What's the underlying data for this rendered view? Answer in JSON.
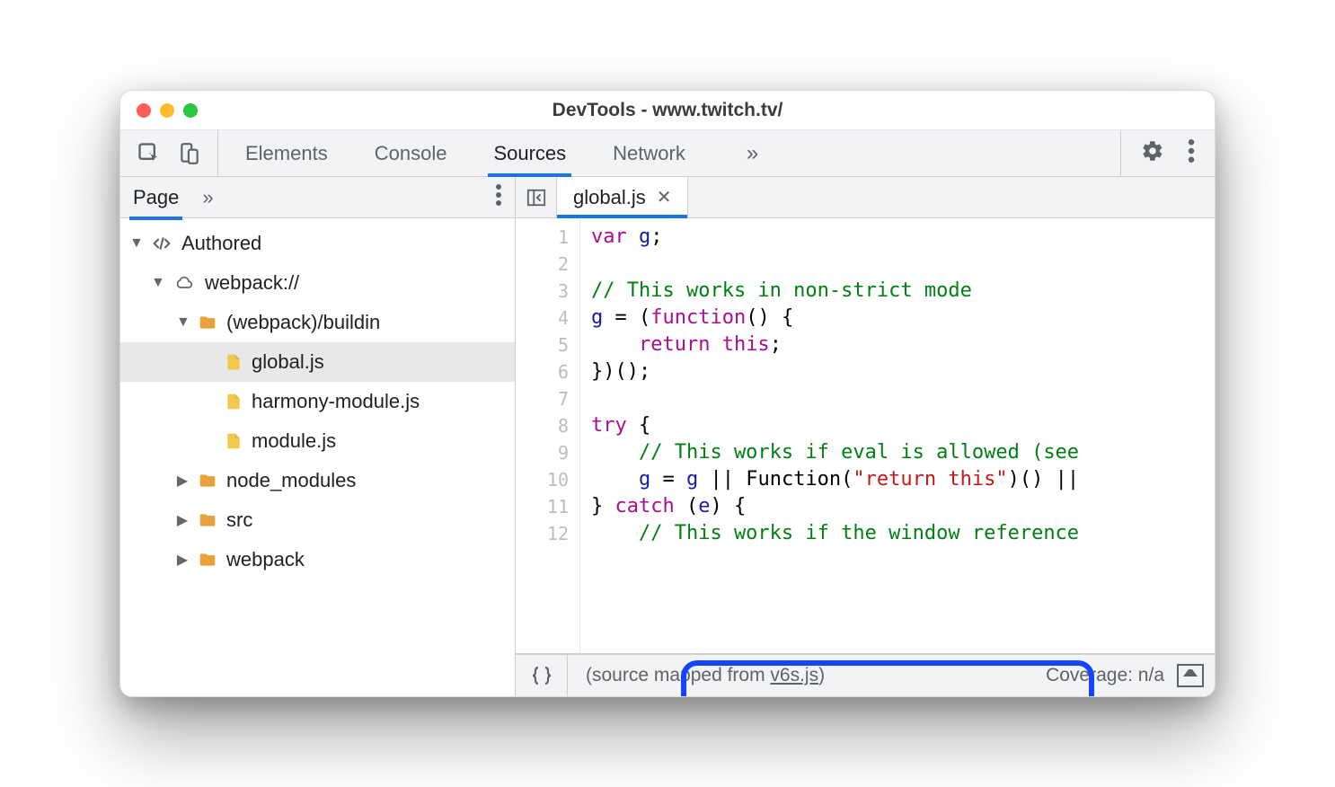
{
  "window": {
    "title": "DevTools - www.twitch.tv/"
  },
  "topTabs": {
    "items": [
      "Elements",
      "Console",
      "Sources",
      "Network"
    ],
    "activeIndex": 2,
    "more": "»"
  },
  "sidebar": {
    "tabs": {
      "active": "Page",
      "more": "»"
    },
    "tree": {
      "root": "Authored",
      "origin": "webpack://",
      "folderOpen": "(webpack)/buildin",
      "filesOpen": [
        "global.js",
        "harmony-module.js",
        "module.js"
      ],
      "foldersClosed": [
        "node_modules",
        "src",
        "webpack"
      ],
      "selected": "global.js"
    }
  },
  "editor": {
    "openTab": "global.js",
    "lineCount": 12,
    "code": {
      "l1": {
        "a": "var ",
        "b": "g",
        "c": ";"
      },
      "l2": "",
      "l3": "// This works in non-strict mode",
      "l4": {
        "a": "g",
        "b": " = (",
        "c": "function",
        "d": "() {"
      },
      "l5": {
        "a": "    ",
        "b": "return this",
        "c": ";"
      },
      "l6": "})();",
      "l7": "",
      "l8": {
        "a": "try",
        "b": " {"
      },
      "l9": "    // This works if eval is allowed (see",
      "l10": {
        "a": "    ",
        "b": "g",
        "c": " = ",
        "d": "g",
        "e": " || Function(",
        "f": "\"return this\"",
        "g": ")() ||"
      },
      "l11": {
        "a": "} ",
        "b": "catch",
        "c": " (",
        "d": "e",
        "e": ") {"
      },
      "l12": "    // This works if the window reference"
    },
    "status": {
      "mappedPrefix": "(source mapped from ",
      "mappedLink": "v6s.js",
      "mappedSuffix": ")",
      "coverage": "Coverage: n/a"
    }
  }
}
